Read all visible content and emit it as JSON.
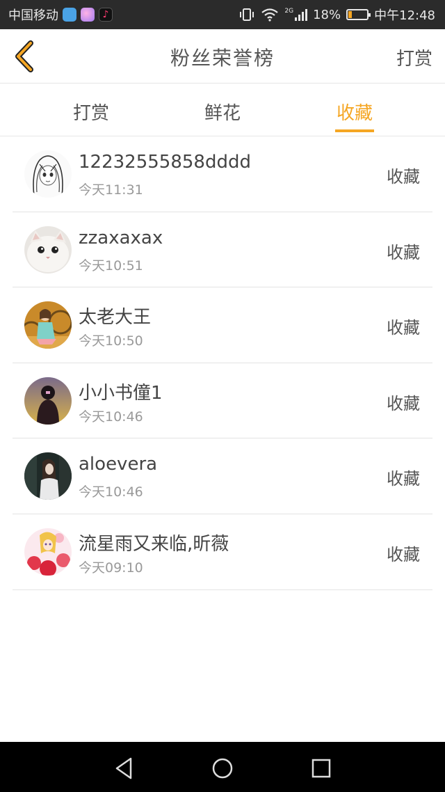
{
  "status_bar": {
    "carrier": "中国移动",
    "network": "2G",
    "battery_text": "18%",
    "battery_level": 0.18,
    "time": "中午12:48",
    "icons": [
      "shield-app-icon",
      "candy-app-icon",
      "tiktok-app-icon",
      "vibrate-icon",
      "wifi-icon",
      "signal-icon",
      "battery-icon"
    ]
  },
  "header": {
    "title": "粉丝荣誉榜",
    "right_action": "打赏",
    "back_icon": "chevron-left-icon",
    "accent_color": "#f5a623"
  },
  "tabs": [
    {
      "label": "打赏",
      "active": false
    },
    {
      "label": "鲜花",
      "active": false
    },
    {
      "label": "收藏",
      "active": true
    }
  ],
  "list": [
    {
      "name": "12232555858dddd",
      "time": "今天11:31",
      "action": "收藏",
      "avatar": "sketch-girl-avatar"
    },
    {
      "name": "zzaxaxax",
      "time": "今天10:51",
      "action": "收藏",
      "avatar": "white-cat-avatar"
    },
    {
      "name": "太老大王",
      "time": "今天10:50",
      "action": "收藏",
      "avatar": "girl-bicycle-avatar"
    },
    {
      "name": "小小书僮1",
      "time": "今天10:46",
      "action": "收藏",
      "avatar": "girl-back-avatar"
    },
    {
      "name": "aloevera",
      "time": "今天10:46",
      "action": "收藏",
      "avatar": "girl-dark-avatar"
    },
    {
      "name": "流星雨又来临,昕薇",
      "time": "今天09:10",
      "action": "收藏",
      "avatar": "anime-flowers-avatar"
    }
  ],
  "nav_bar": {
    "buttons": [
      "back-triangle-icon",
      "home-circle-icon",
      "recents-square-icon"
    ]
  }
}
